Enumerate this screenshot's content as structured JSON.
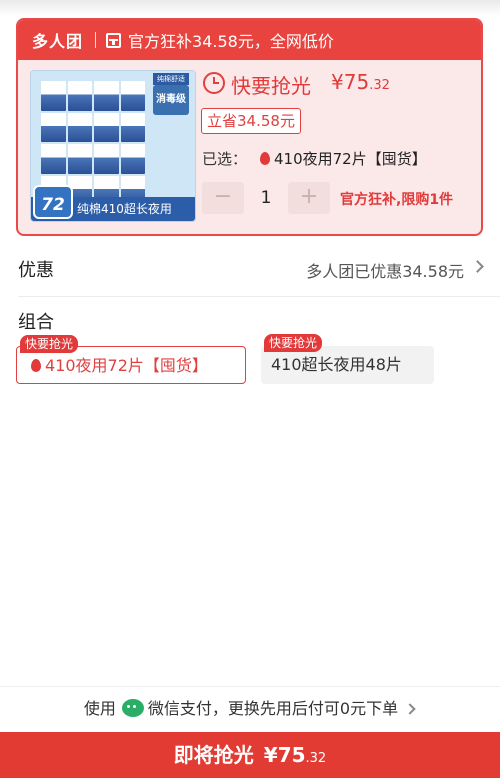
{
  "promo": {
    "tag": "多人团",
    "subsidy_text": "官方狂补34.58元，全网低价",
    "status": "快要抢光",
    "price_main": "¥75",
    "price_decimal": ".32",
    "save_badge": "立省34.58元",
    "selected_label": "已选：",
    "selected_value": "410夜用72片【囤货】",
    "quantity": "1",
    "minus": "−",
    "plus": "+",
    "limit": "官方狂补,限购1件",
    "thumb": {
      "count": "72",
      "caption": "纯棉410超长夜用",
      "badge": "消毒级",
      "badge_top": "纯棉舒适"
    }
  },
  "discount": {
    "label": "优惠",
    "value": "多人团已优惠34.58元"
  },
  "combo": {
    "label": "组合",
    "options": [
      {
        "tag": "快要抢光",
        "label": "410夜用72片【囤货】",
        "selected": true
      },
      {
        "tag": "快要抢光",
        "label": "410超长夜用48片",
        "selected": false
      }
    ]
  },
  "payment": {
    "prefix": "使用",
    "text": "微信支付，更换先用后付可0元下单"
  },
  "buy": {
    "label": "即将抢光",
    "price_main": "¥75",
    "price_decimal": ".32"
  },
  "colors": {
    "accent": "#e23a3a",
    "wechat": "#2aae67"
  }
}
